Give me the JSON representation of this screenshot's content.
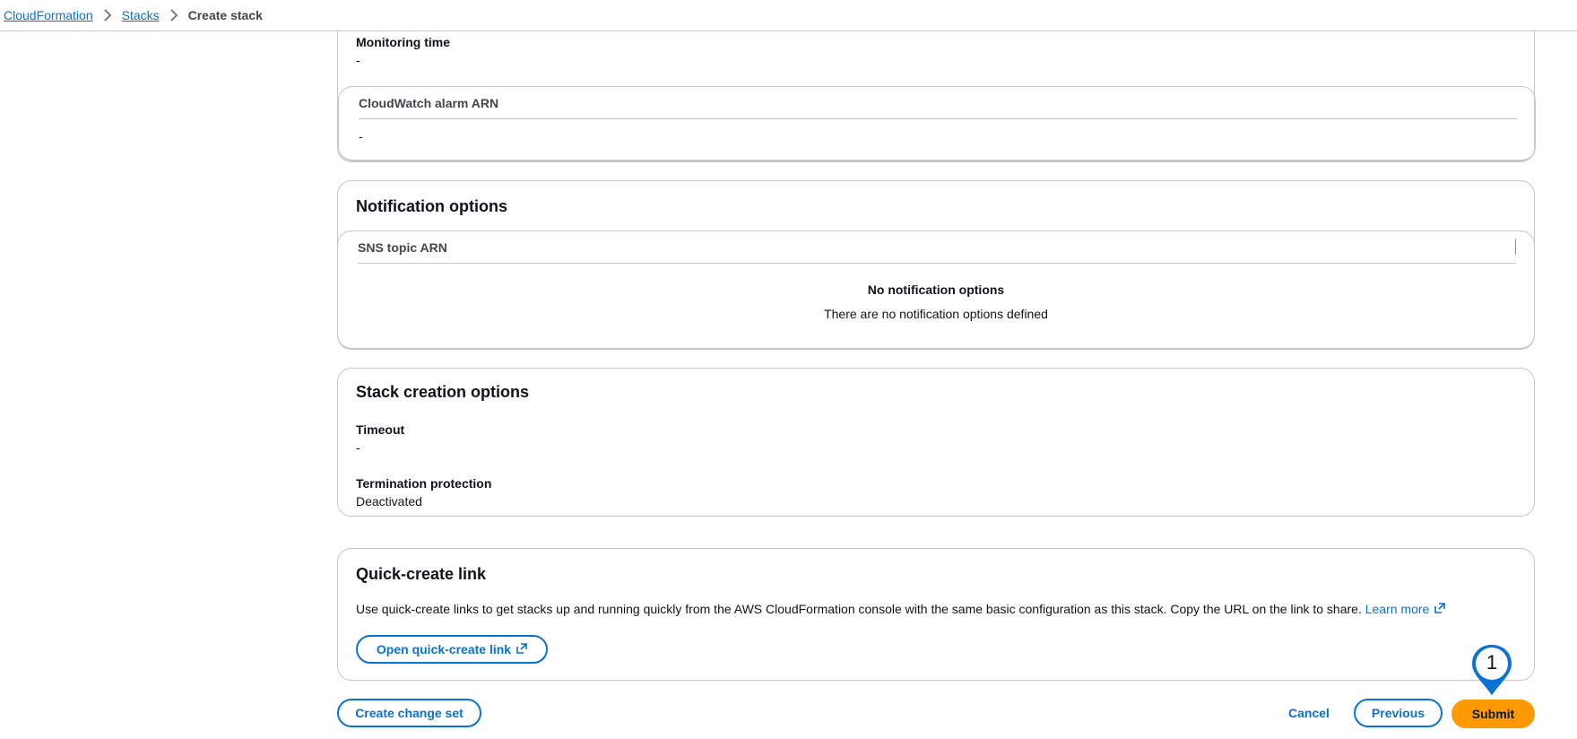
{
  "breadcrumb": {
    "items": [
      "CloudFormation",
      "Stacks"
    ],
    "current": "Create stack"
  },
  "monitoring": {
    "monitoring_time_label": "Monitoring time",
    "monitoring_time_value": "-",
    "alarm_table_header": "CloudWatch alarm ARN",
    "alarm_table_value": "-"
  },
  "notification": {
    "title": "Notification options",
    "table_header": "SNS topic ARN",
    "empty_title": "No notification options",
    "empty_description": "There are no notification options defined"
  },
  "stack_creation": {
    "title": "Stack creation options",
    "timeout_label": "Timeout",
    "timeout_value": "-",
    "termination_label": "Termination protection",
    "termination_value": "Deactivated"
  },
  "quick_create": {
    "title": "Quick-create link",
    "description": "Use quick-create links to get stacks up and running quickly from the AWS CloudFormation console with the same basic configuration as this stack. Copy the URL on the link to share.",
    "learn_more": "Learn more",
    "open_button": "Open quick-create link"
  },
  "footer": {
    "create_change_set": "Create change set",
    "cancel": "Cancel",
    "previous": "Previous",
    "submit": "Submit"
  },
  "step_marker": {
    "number": "1",
    "color": "#0972d3"
  },
  "colors": {
    "link": "#0972d3",
    "primary_button": "#ff9900",
    "border": "#c6c6cd"
  },
  "icons": [
    "chevron-right-icon",
    "external-link-icon"
  ]
}
